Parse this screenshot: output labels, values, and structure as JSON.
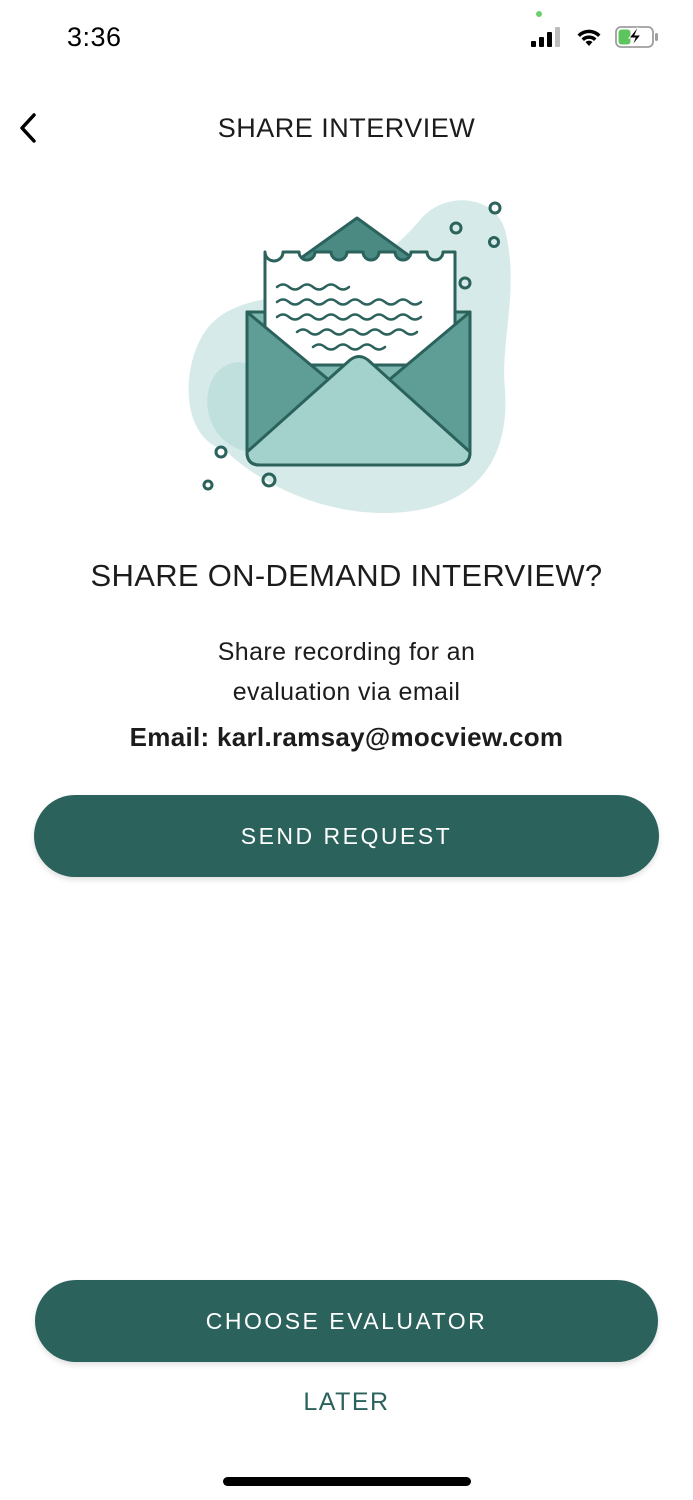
{
  "status_bar": {
    "time": "3:36",
    "icons": [
      "signal-icon",
      "wifi-icon",
      "battery-charging-icon"
    ]
  },
  "nav": {
    "back_icon": "chevron-left-icon",
    "title": "SHARE INTERVIEW"
  },
  "illustration": {
    "icon": "open-envelope-letter-illustration",
    "accent_color": "#2b625c",
    "fill_color": "#9fcfcb"
  },
  "content": {
    "headline": "SHARE ON-DEMAND INTERVIEW?",
    "description_line1": "Share recording for an",
    "description_line2": "evaluation via email",
    "email_label": "Email: karl.ramsay@mocview.com"
  },
  "actions": {
    "send_request_label": "SEND REQUEST",
    "choose_evaluator_label": "CHOOSE EVALUATOR",
    "later_label": "LATER"
  },
  "colors": {
    "primary": "#2b625c",
    "text": "#1c1c1c",
    "background": "#ffffff"
  }
}
